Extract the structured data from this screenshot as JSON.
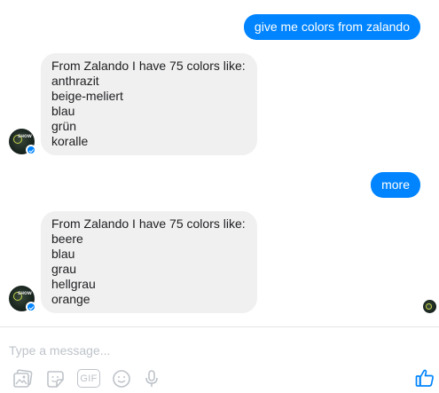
{
  "conversation": {
    "outgoing": [
      {
        "text": "give me colors from zalando"
      },
      {
        "text": "more"
      }
    ],
    "incoming": [
      {
        "lines": [
          "From Zalando I have 75 colors like:",
          "anthrazit",
          "beige-meliert",
          "blau",
          "grün",
          "koralle"
        ]
      },
      {
        "lines": [
          "From Zalando I have 75 colors like:",
          "beere",
          "blau",
          "grau",
          "hellgrau",
          "orange"
        ]
      }
    ],
    "bot_avatar": {
      "logo_text": "SHOW"
    }
  },
  "composer": {
    "placeholder": "Type a message...",
    "value": "",
    "gif_label": "GIF",
    "icons": [
      "image-icon",
      "sticker-icon",
      "gif-icon",
      "emoji-icon",
      "microphone-icon",
      "thumbs-up-icon"
    ]
  },
  "colors": {
    "accent": "#0084ff",
    "incoming_bubble": "#f1f0f0",
    "placeholder": "#bec3c9",
    "icon_gray": "#bec3c9"
  }
}
